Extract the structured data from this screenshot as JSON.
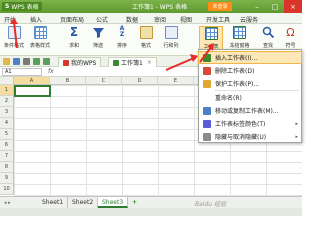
{
  "titlebar": {
    "app_name": "WPS 表格",
    "logo_glyph": "S",
    "doc_title": "工作簿1 - WPS 表格",
    "login_label": "未登录",
    "controls": [
      "–",
      "□",
      "×"
    ]
  },
  "menu": {
    "tabs": [
      "开始",
      "插入",
      "页面布局",
      "公式",
      "数据",
      "审阅",
      "视图",
      "开发工具",
      "云服务"
    ]
  },
  "ribbon": {
    "buttons": [
      "条件格式",
      "表格样式",
      "求和",
      "筛选",
      "排序",
      "格式",
      "行和列",
      "工作表",
      "冻结窗格",
      "查找",
      "符号"
    ]
  },
  "quickbar": {
    "tabs": [
      "我的WPS",
      "工作簿1"
    ],
    "close_glyph": "×"
  },
  "formula": {
    "cell_ref": "A1",
    "fx_label": "fx"
  },
  "grid": {
    "columns": [
      "A",
      "B",
      "C",
      "D",
      "E",
      "F",
      "G",
      "H"
    ],
    "rows": [
      "1",
      "2",
      "3",
      "4",
      "5",
      "6",
      "7",
      "8",
      "9",
      "10"
    ]
  },
  "dropdown": {
    "items": [
      {
        "label": "插入工作表(I)...",
        "arrow": ""
      },
      {
        "label": "删除工作表(D)",
        "arrow": ""
      },
      {
        "label": "保护工作表(P)...",
        "arrow": ""
      },
      {
        "label": "重命名(R)",
        "arrow": ""
      },
      {
        "label": "移动或复制工作表(M)...",
        "arrow": ""
      },
      {
        "label": "工作表标签颜色(T)",
        "arrow": "▸"
      },
      {
        "label": "隐藏与取消隐藏(U)",
        "arrow": "▸"
      }
    ]
  },
  "sheets": {
    "nav": "◂ ▸",
    "tabs": [
      "Sheet1",
      "Sheet2",
      "Sheet3"
    ],
    "add": "+"
  },
  "watermark": "Baidu 经验",
  "colors": {
    "accent": "#5e9a30",
    "highlight": "#fde7b6",
    "annotation": "#e52a2a"
  }
}
